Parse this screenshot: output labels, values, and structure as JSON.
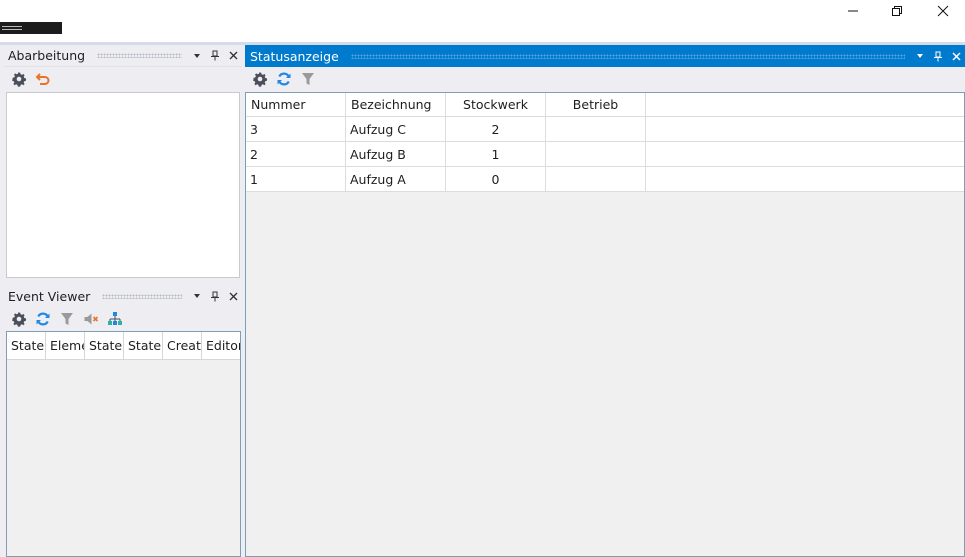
{
  "window": {
    "minimize_glyph": "—",
    "maximize_glyph": "❐",
    "close_glyph": "✕"
  },
  "panels": {
    "abarbeitung": {
      "title": "Abarbeitung",
      "toolbar": [
        "gear-icon",
        "undo-icon"
      ]
    },
    "event_viewer": {
      "title": "Event Viewer",
      "toolbar": [
        "gear-icon",
        "refresh-icon",
        "filter-icon",
        "mute-icon",
        "hierarchy-icon"
      ],
      "columns": [
        "State",
        "Eleme",
        "State",
        "State",
        "Creat",
        "Editor"
      ]
    },
    "statusanzeige": {
      "title": "Statusanzeige",
      "toolbar": [
        "gear-icon",
        "refresh-icon",
        "filter-icon"
      ],
      "columns": [
        "Nummer",
        "Bezeichnung",
        "Stockwerk",
        "Betrieb"
      ],
      "rows": [
        {
          "nummer": "3",
          "bezeichnung": "Aufzug C",
          "stockwerk": "2",
          "betrieb": ""
        },
        {
          "nummer": "2",
          "bezeichnung": "Aufzug B",
          "stockwerk": "1",
          "betrieb": ""
        },
        {
          "nummer": "1",
          "bezeichnung": "Aufzug A",
          "stockwerk": "0",
          "betrieb": ""
        }
      ]
    }
  },
  "header_buttons": {
    "menu": "▾",
    "pin": "📌",
    "close": "✕"
  },
  "colors": {
    "accent": "#007acc",
    "gear": "#4b4f5a",
    "refresh": "#1e88e5",
    "undo": "#e8742b",
    "filter": "#9a9a9a"
  }
}
